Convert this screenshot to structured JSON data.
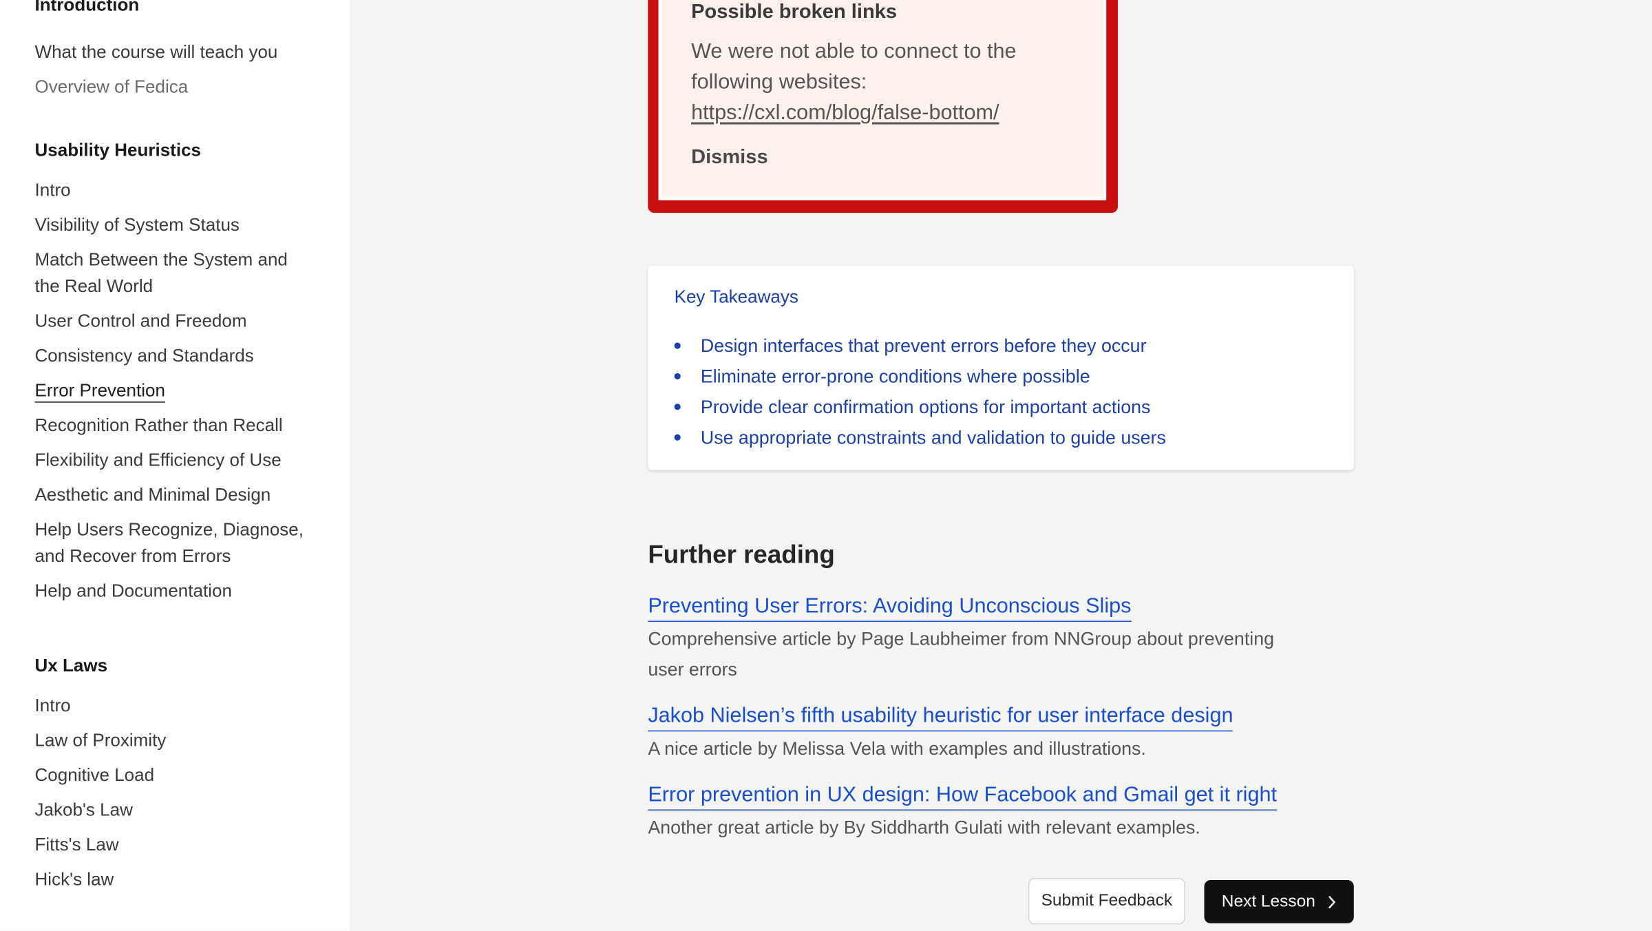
{
  "sidebar": {
    "introduction": {
      "heading": "Introduction",
      "items": [
        "What the course will teach you",
        "Overview of Fedica"
      ]
    },
    "usability": {
      "heading": "Usability Heuristics",
      "items": [
        "Intro",
        "Visibility of System Status",
        "Match Between the System and the Real World",
        "User Control and Freedom",
        "Consistency and Standards",
        "Error Prevention",
        "Recognition Rather than Recall",
        "Flexibility and Efficiency of Use",
        "Aesthetic and Minimal Design",
        "Help Users Recognize, Diagnose, and Recover from Errors",
        "Help and Documentation"
      ]
    },
    "uxlaws": {
      "heading": "Ux Laws",
      "items": [
        "Intro",
        "Law of Proximity",
        "Cognitive Load",
        "Jakob's Law",
        "Fitts's Law",
        "Hick's law"
      ]
    }
  },
  "alert": {
    "title": "Possible broken links",
    "text": "We were not able to connect to the following websites:",
    "link": "https://cxl.com/blog/false-bottom/",
    "dismiss": "Dismiss"
  },
  "takeaways": {
    "title": "Key Takeaways",
    "items": [
      "Design interfaces that prevent errors before they occur",
      "Eliminate error-prone conditions where possible",
      "Provide clear confirmation options for important actions",
      "Use appropriate constraints and validation to guide users"
    ]
  },
  "further_reading": {
    "title": "Further reading",
    "entries": [
      {
        "link": "Preventing User Errors: Avoiding Unconscious Slips",
        "desc": "Comprehensive article by Page Laubheimer from NNGroup about preventing user errors"
      },
      {
        "link": "Jakob Nielsen’s fifth usability heuristic for user interface design",
        "desc": "A nice article by Melissa Vela with examples and illustrations."
      },
      {
        "link": "Error prevention in UX design: How Facebook and Gmail get it right",
        "desc": "Another great article by By Siddharth Gulati with relevant examples."
      }
    ]
  },
  "buttons": {
    "feedback": "Submit Feedback",
    "next": "Next Lesson"
  },
  "colors": {
    "alert_border": "#c80f10",
    "link_blue": "#1a4fd0",
    "takeaway_blue": "#1a3fa8",
    "button_dark": "#111111"
  }
}
